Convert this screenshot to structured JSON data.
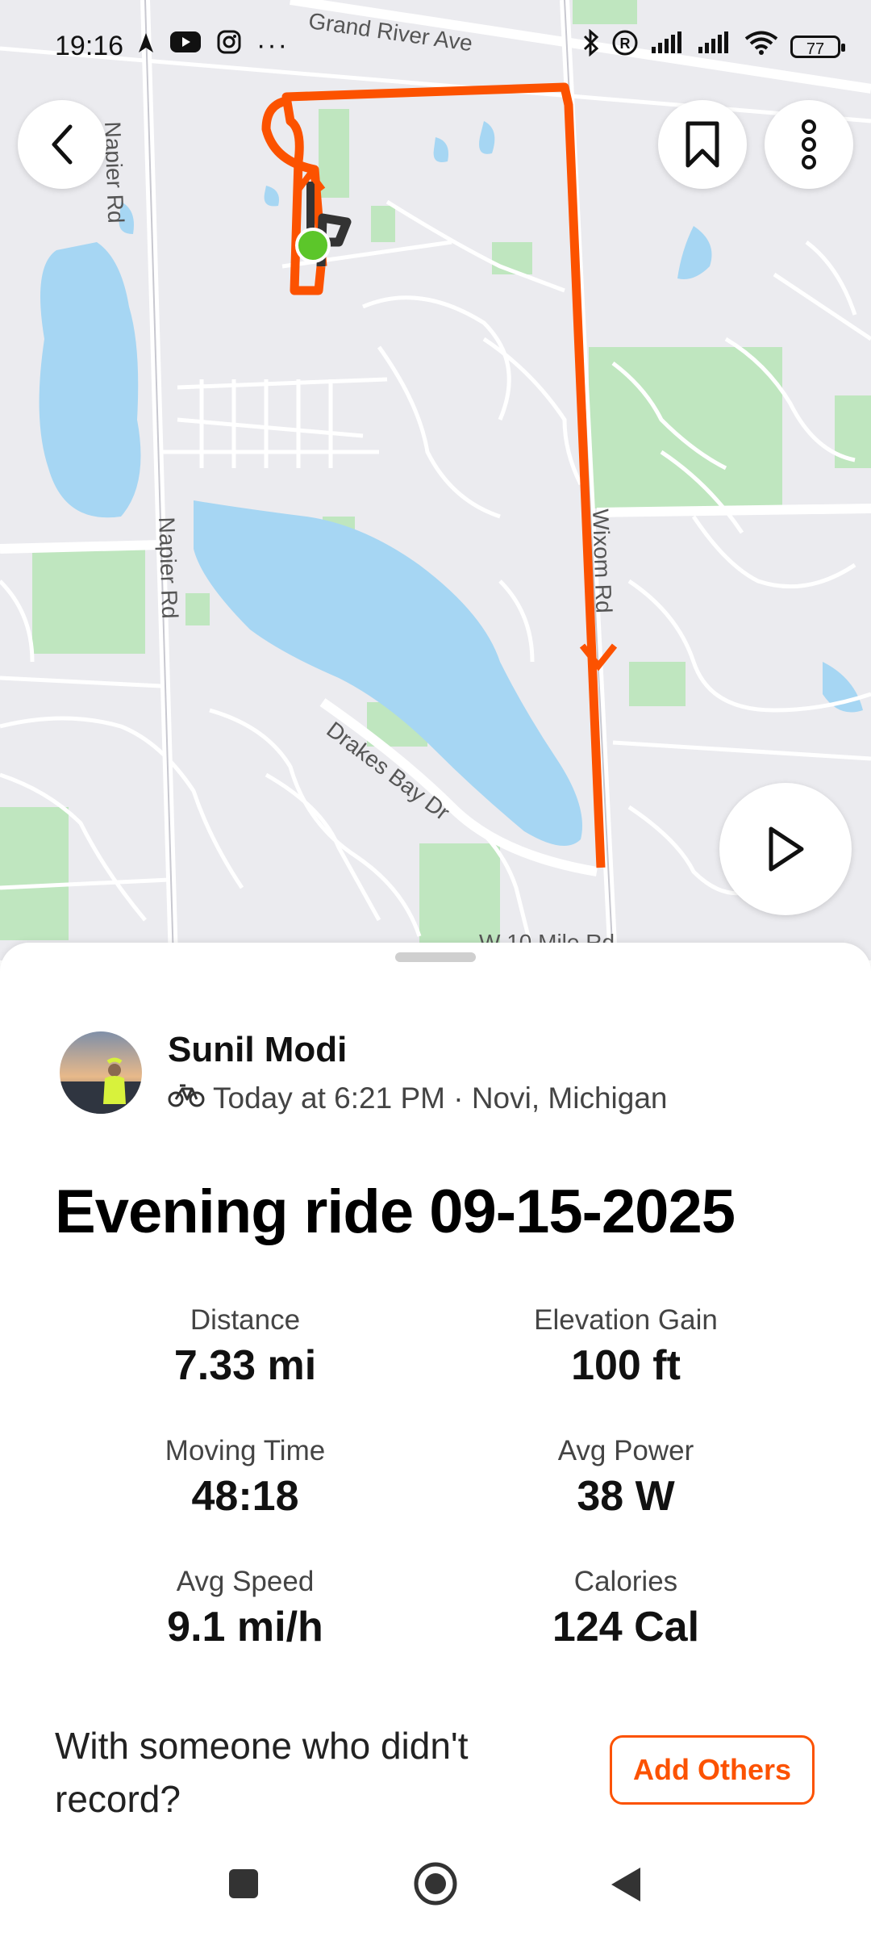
{
  "status_bar": {
    "time": "19:16",
    "battery": "77",
    "icons": [
      "navigation-icon",
      "youtube-icon",
      "instagram-icon",
      "more-dots-icon",
      "bluetooth-icon",
      "registered-icon",
      "signal-icon",
      "signal-icon",
      "wifi-icon",
      "battery-icon"
    ]
  },
  "map": {
    "road_labels": {
      "grand_river": "Grand River Ave",
      "napier_top": "Napier Rd",
      "napier_mid": "Napier Rd",
      "wixom": "Wixom Rd",
      "drakes_bay": "Drakes Bay Dr",
      "ten_mile": "W 10 Mile Rd"
    },
    "route_color": "#fc5200",
    "start_color": "#5cc62a"
  },
  "activity": {
    "athlete_name": "Sunil Modi",
    "meta": "Today at 6:21 PM · Novi, Michigan",
    "activity_icon": "bike-icon",
    "title": "Evening ride 09-15-2025",
    "stats": [
      {
        "label": "Distance",
        "value": "7.33 mi"
      },
      {
        "label": "Elevation Gain",
        "value": "100 ft"
      },
      {
        "label": "Moving Time",
        "value": "48:18"
      },
      {
        "label": "Avg Power",
        "value": "38 W"
      },
      {
        "label": "Avg Speed",
        "value": "9.1 mi/h"
      },
      {
        "label": "Calories",
        "value": "124 Cal"
      }
    ],
    "add_prompt": "With someone who didn't record?",
    "add_button": "Add Others"
  },
  "colors": {
    "accent": "#fc5200"
  }
}
